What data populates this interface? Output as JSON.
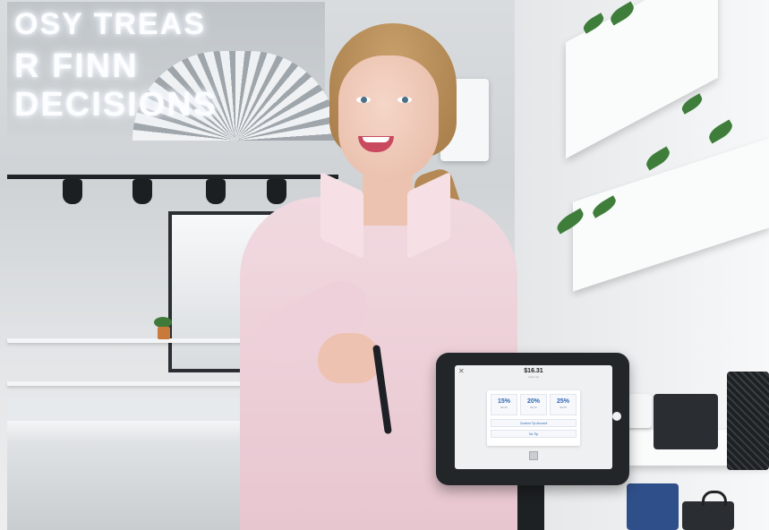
{
  "scene": {
    "sign": {
      "line1": "OSY TREAS",
      "line2": "R FINN DECISIONS"
    },
    "colors": {
      "shirt": "#f1d9e0",
      "tablet": "#222629",
      "accent_blue": "#2f68b5"
    }
  },
  "tablet_screen": {
    "close_icon": "✕",
    "amount": "$16.31",
    "amount_sub": "Add a tip",
    "tips": [
      {
        "percent": "15%",
        "amount": "$2.45"
      },
      {
        "percent": "20%",
        "amount": "$3.26"
      },
      {
        "percent": "25%",
        "amount": "$4.08"
      }
    ],
    "custom_label": "Custom Tip Amount",
    "no_tip_label": "No Tip"
  }
}
